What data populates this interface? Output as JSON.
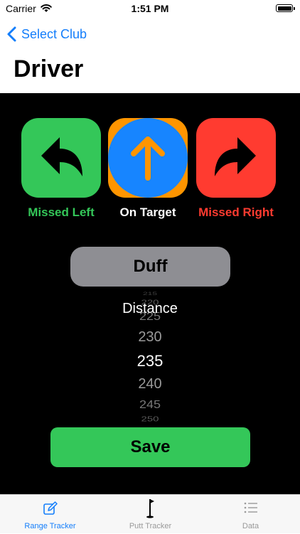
{
  "status_bar": {
    "carrier": "Carrier",
    "time": "1:51 PM",
    "wifi_icon": "wifi-icon",
    "battery_icon": "battery-icon"
  },
  "nav": {
    "back_label": "Select Club",
    "title": "Driver"
  },
  "targets": [
    {
      "label": "Missed Left",
      "icon": "arrow-turn-left-icon",
      "color": "#34c759"
    },
    {
      "label": "On Target",
      "icon": "arrow-up-icon",
      "color": "#ffffff"
    },
    {
      "label": "Missed Right",
      "icon": "arrow-turn-right-icon",
      "color": "#ff3b30"
    }
  ],
  "duff_label": "Duff",
  "distance_picker": {
    "label": "Distance",
    "values": [
      "215",
      "220",
      "225",
      "230",
      "235",
      "240",
      "245",
      "250"
    ],
    "selected": "235"
  },
  "save_label": "Save",
  "tab_bar": {
    "tabs": [
      {
        "label": "Range Tracker",
        "icon": "edit-square-icon",
        "active": true
      },
      {
        "label": "Putt Tracker",
        "icon": "golf-flag-icon",
        "active": false
      },
      {
        "label": "Data",
        "icon": "list-icon",
        "active": false
      }
    ]
  },
  "colors": {
    "accent": "#147efb",
    "green": "#34c759",
    "red": "#ff3b30",
    "orange": "#ff9500",
    "blue_circle": "#1785ff",
    "gray_button": "#8e8e93"
  }
}
